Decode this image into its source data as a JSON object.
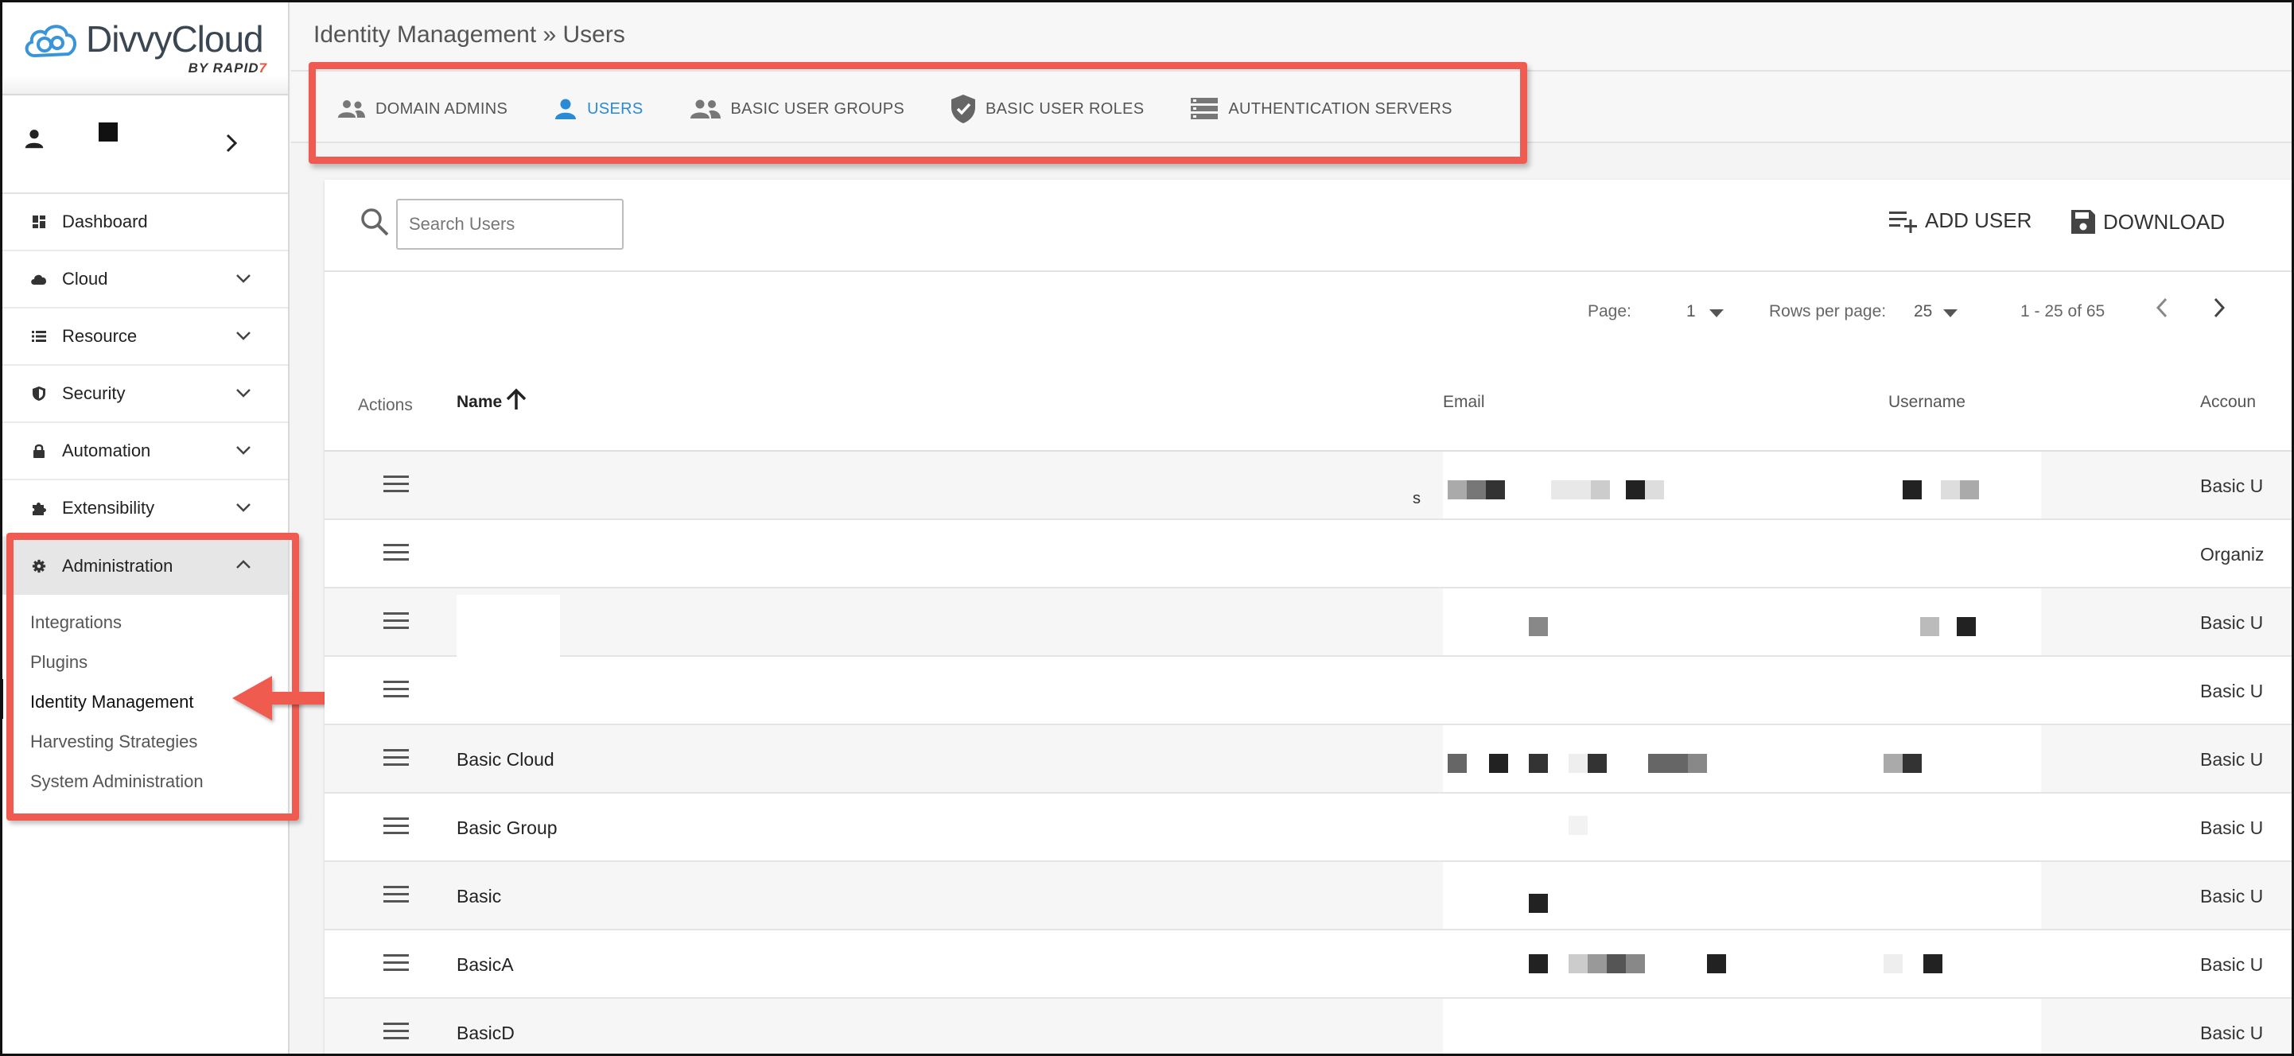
{
  "brand": {
    "name": "DivvyCloud",
    "byline": "BY",
    "company": "RAPID",
    "company_mark": "7"
  },
  "sidebar": {
    "nav": [
      {
        "label": "Dashboard",
        "icon": "dashboard-icon",
        "expandable": false
      },
      {
        "label": "Cloud",
        "icon": "cloud-icon",
        "expandable": true
      },
      {
        "label": "Resource",
        "icon": "list-icon",
        "expandable": true
      },
      {
        "label": "Security",
        "icon": "shield-icon",
        "expandable": true
      },
      {
        "label": "Automation",
        "icon": "lock-icon",
        "expandable": true
      },
      {
        "label": "Extensibility",
        "icon": "puzzle-icon",
        "expandable": true
      },
      {
        "label": "Administration",
        "icon": "gear-icon",
        "expandable": true,
        "expanded": true
      }
    ],
    "admin_sub": [
      {
        "label": "Integrations"
      },
      {
        "label": "Plugins"
      },
      {
        "label": "Identity Management",
        "active": true
      },
      {
        "label": "Harvesting Strategies"
      },
      {
        "label": "System Administration"
      }
    ]
  },
  "header": {
    "breadcrumb": "Identity Management » Users"
  },
  "tabs": [
    {
      "label": "DOMAIN ADMINS",
      "icon": "people-icon",
      "active": false
    },
    {
      "label": "USERS",
      "icon": "person-icon",
      "active": true
    },
    {
      "label": "BASIC USER GROUPS",
      "icon": "group-icon",
      "active": false
    },
    {
      "label": "BASIC USER ROLES",
      "icon": "shield-check-icon",
      "active": false
    },
    {
      "label": "AUTHENTICATION SERVERS",
      "icon": "server-icon",
      "active": false
    }
  ],
  "toolbar": {
    "search_placeholder": "Search Users",
    "add_label": "ADD USER",
    "download_label": "DOWNLOAD"
  },
  "pagination": {
    "page_label": "Page:",
    "page_value": "1",
    "rows_label": "Rows per page:",
    "rows_value": "25",
    "range": "1 - 25 of 65"
  },
  "table": {
    "columns": {
      "actions": "Actions",
      "name": "Name",
      "email": "Email",
      "username": "Username",
      "account": "Accoun"
    },
    "rows": [
      {
        "name": "",
        "account": "Basic U",
        "prefix": "s"
      },
      {
        "name": "",
        "account": "Organiz"
      },
      {
        "name": "",
        "account": "Basic U"
      },
      {
        "name": "",
        "account": "Basic U"
      },
      {
        "name": "Basic Cloud",
        "account": "Basic U"
      },
      {
        "name": "Basic Group",
        "account": "Basic U"
      },
      {
        "name": "Basic",
        "account": "Basic U"
      },
      {
        "name": "BasicA",
        "account": "Basic U"
      },
      {
        "name": "BasicD",
        "account": "Basic U"
      }
    ]
  },
  "colors": {
    "accent": "#2b8ad6",
    "annotation": "#ef5b50",
    "text": "#222222"
  }
}
